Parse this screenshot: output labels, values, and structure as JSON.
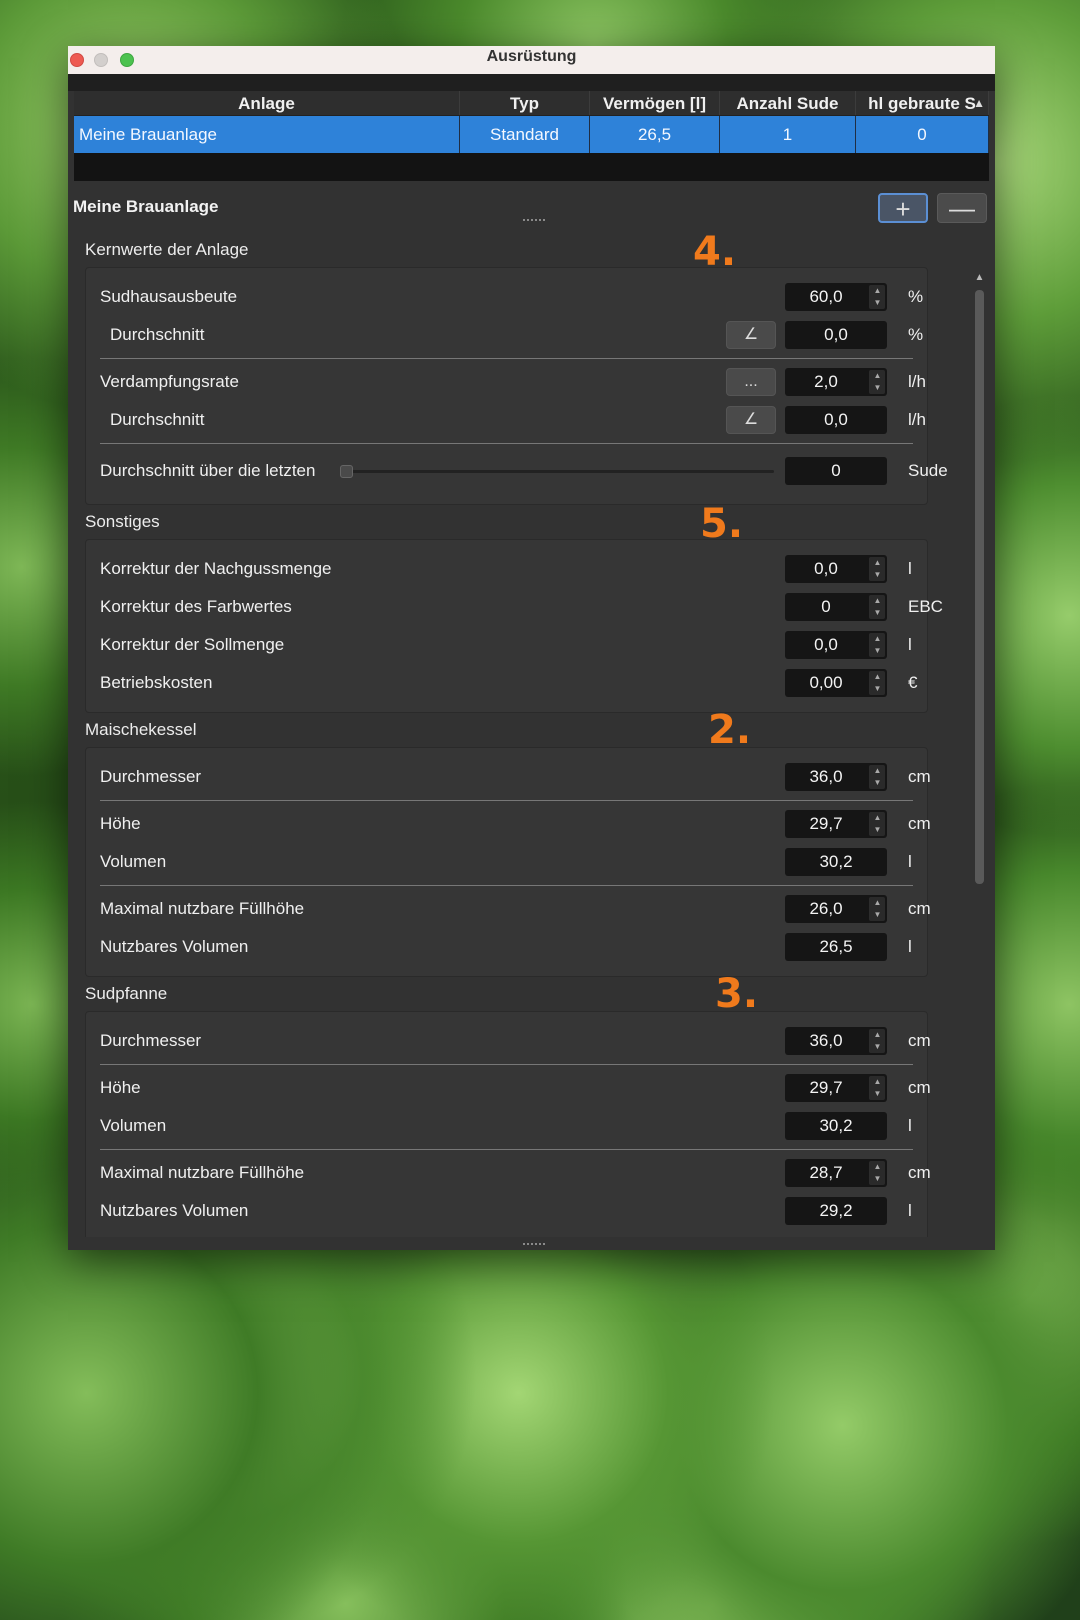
{
  "window": {
    "title": "Ausrüstung"
  },
  "table": {
    "headers": [
      "Anlage",
      "Typ",
      "Vermögen [l]",
      "Anzahl Sude",
      "hl gebraute S"
    ],
    "row": {
      "anlage": "Meine Brauanlage",
      "typ": "Standard",
      "vermoegen": "26,5",
      "anzahl": "1",
      "gebraut": "0"
    }
  },
  "detail": {
    "title": "Meine Brauanlage",
    "add": "+",
    "remove": "—"
  },
  "kernwerte": {
    "title": "Kernwerte der Anlage",
    "sudhausausbeute": {
      "label": "Sudhausausbeute",
      "value": "60,0",
      "unit": "%"
    },
    "sha_durchschnitt": {
      "label": "Durchschnitt",
      "value": "0,0",
      "unit": "%"
    },
    "verdampfung": {
      "label": "Verdampfungsrate",
      "value": "2,0",
      "unit": "l/h",
      "button": "..."
    },
    "verd_durchschnitt": {
      "label": "Durchschnitt",
      "value": "0,0",
      "unit": "l/h"
    },
    "letzten": {
      "label": "Durchschnitt über die letzten",
      "value": "0",
      "unit": "Sude",
      "slider_fraction": 0
    }
  },
  "sonstiges": {
    "title": "Sonstiges",
    "nachguss": {
      "label": "Korrektur der Nachgussmenge",
      "value": "0,0",
      "unit": "l"
    },
    "farbwert": {
      "label": "Korrektur des Farbwertes",
      "value": "0",
      "unit": "EBC"
    },
    "sollmenge": {
      "label": "Korrektur der Sollmenge",
      "value": "0,0",
      "unit": "l"
    },
    "betriebskosten": {
      "label": "Betriebskosten",
      "value": "0,00",
      "unit": "€"
    }
  },
  "maischekessel": {
    "title": "Maischekessel",
    "durchmesser": {
      "label": "Durchmesser",
      "value": "36,0",
      "unit": "cm"
    },
    "hoehe": {
      "label": "Höhe",
      "value": "29,7",
      "unit": "cm"
    },
    "volumen": {
      "label": "Volumen",
      "value": "30,2",
      "unit": "l"
    },
    "fuellhoehe": {
      "label": "Maximal nutzbare Füllhöhe",
      "value": "26,0",
      "unit": "cm"
    },
    "nutzvolumen": {
      "label": "Nutzbares Volumen",
      "value": "26,5",
      "unit": "l"
    }
  },
  "sudpfanne": {
    "title": "Sudpfanne",
    "durchmesser": {
      "label": "Durchmesser",
      "value": "36,0",
      "unit": "cm"
    },
    "hoehe": {
      "label": "Höhe",
      "value": "29,7",
      "unit": "cm"
    },
    "volumen": {
      "label": "Volumen",
      "value": "30,2",
      "unit": "l"
    },
    "fuellhoehe": {
      "label": "Maximal nutzbare Füllhöhe",
      "value": "28,7",
      "unit": "cm"
    },
    "nutzvolumen": {
      "label": "Nutzbares Volumen",
      "value": "29,2",
      "unit": "l"
    }
  },
  "annotations": {
    "a4": "4.",
    "a5": "5.",
    "a2": "2.",
    "a3": "3."
  },
  "colors": {
    "selection": "#2e82d9",
    "annotation": "#f07a1c",
    "window_bg": "#323232"
  }
}
